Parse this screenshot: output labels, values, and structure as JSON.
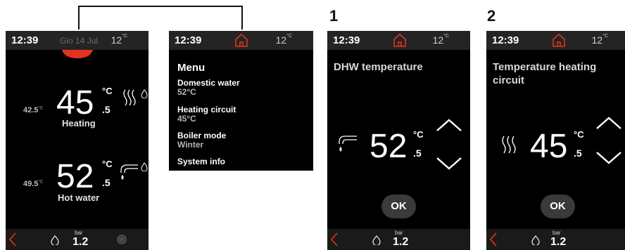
{
  "steps": [
    "1",
    "2"
  ],
  "main": {
    "time": "12:39",
    "date": "Gio 14 Jul",
    "outdoor_temp": "12",
    "outdoor_unit": "°C",
    "heating": {
      "set": "42.5",
      "set_unit": "°C",
      "value": "45",
      "unit": "°C",
      "decimal": ".5",
      "label": "Heating"
    },
    "hot_water": {
      "set": "49.5",
      "set_unit": "°C",
      "value": "52",
      "unit": "°C",
      "decimal": ".5",
      "label": "Hot water"
    },
    "pressure_unit": "bar",
    "pressure": "1.2"
  },
  "menu": {
    "time": "12:39",
    "outdoor_temp": "12",
    "outdoor_unit": "°C",
    "title": "Menu",
    "items": [
      {
        "label": "Domestic water",
        "value": "52°C"
      },
      {
        "label": "Heating circuit",
        "value": "45°C"
      },
      {
        "label": "Boiler mode",
        "value": "Winter"
      },
      {
        "label": "System info",
        "value": ""
      }
    ]
  },
  "dhw": {
    "time": "12:39",
    "outdoor_temp": "12",
    "outdoor_unit": "°C",
    "title": "DHW temperature",
    "value": "52",
    "unit": "°C",
    "decimal": ".5",
    "ok": "OK",
    "pressure_unit": "bar",
    "pressure": "1.2"
  },
  "heating_circuit": {
    "time": "12:39",
    "outdoor_temp": "12",
    "outdoor_unit": "°C",
    "title_line1": "Temperature heating",
    "title_line2": "circuit",
    "value": "45",
    "unit": "°C",
    "decimal": ".5",
    "ok": "OK",
    "pressure_unit": "bar",
    "pressure": "1.2"
  },
  "colors": {
    "accent_red": "#e3331f",
    "screen_bg": "#000000",
    "bar_bg": "#242424"
  }
}
